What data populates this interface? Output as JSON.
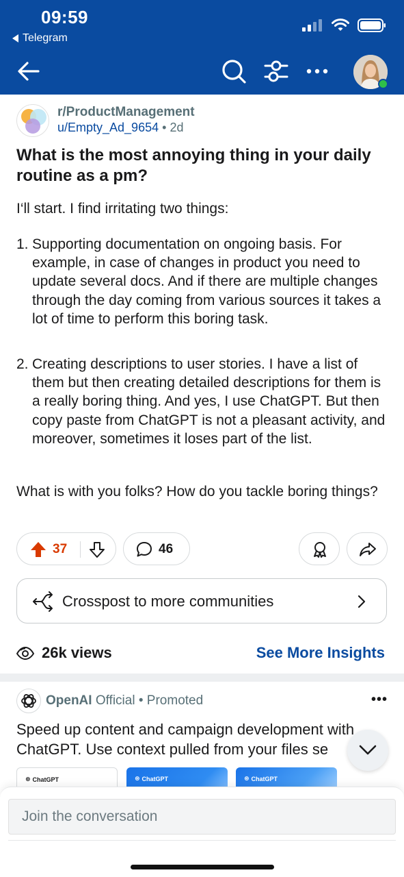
{
  "status_bar": {
    "time": "09:59",
    "back_app": "Telegram"
  },
  "nav": {
    "back_icon": "arrow-left-icon",
    "search_icon": "search-icon",
    "filter_icon": "filter-icon",
    "more_icon": "more-horizontal-icon"
  },
  "post": {
    "subreddit": "r/ProductManagement",
    "author": "u/Empty_Ad_9654",
    "separator": "•",
    "age": "2d",
    "title": "What is the most annoying thing in your daily routine as a pm?",
    "intro": "I‘ll start. I find irritating two things:",
    "items": [
      {
        "num": "1.",
        "text": "Supporting documentation on ongoing basis. For example, in case of changes in product you need to update several docs. And if there are multiple changes through the day coming from various sources it takes a lot of time to perform this boring task."
      },
      {
        "num": "2.",
        "text": "Creating descriptions to user stories. I have a list of them but then creating detailed descriptions for them is a really boring thing. And yes, I use ChatGPT. But then copy paste from ChatGPT is not a pleasant activity, and moreover, sometimes it loses part of the list."
      }
    ],
    "outro": "What is with you folks? How do you tackle boring things?",
    "upvotes": "37",
    "comments": "46"
  },
  "crosspost": {
    "label": "Crosspost to more communities"
  },
  "insights": {
    "views": "26k views",
    "link": "See More Insights"
  },
  "promo": {
    "name": "OpenAI",
    "badge": "Official",
    "separator": "•",
    "tag": "Promoted",
    "more": "•••",
    "line1": "Speed up content and campaign development with",
    "line2": "ChatGPT. Use context pulled from your files se",
    "cards": [
      {
        "brand": "ChatGPT"
      },
      {
        "brand": "ChatGPT"
      },
      {
        "brand": "ChatGPT"
      }
    ]
  },
  "composer": {
    "placeholder": "Join the conversation"
  },
  "colors": {
    "header_blue": "#0a4ba0",
    "upvote_orange": "#d93a00",
    "online_green": "#2fbf48",
    "card_blue": "#1a73e8"
  }
}
